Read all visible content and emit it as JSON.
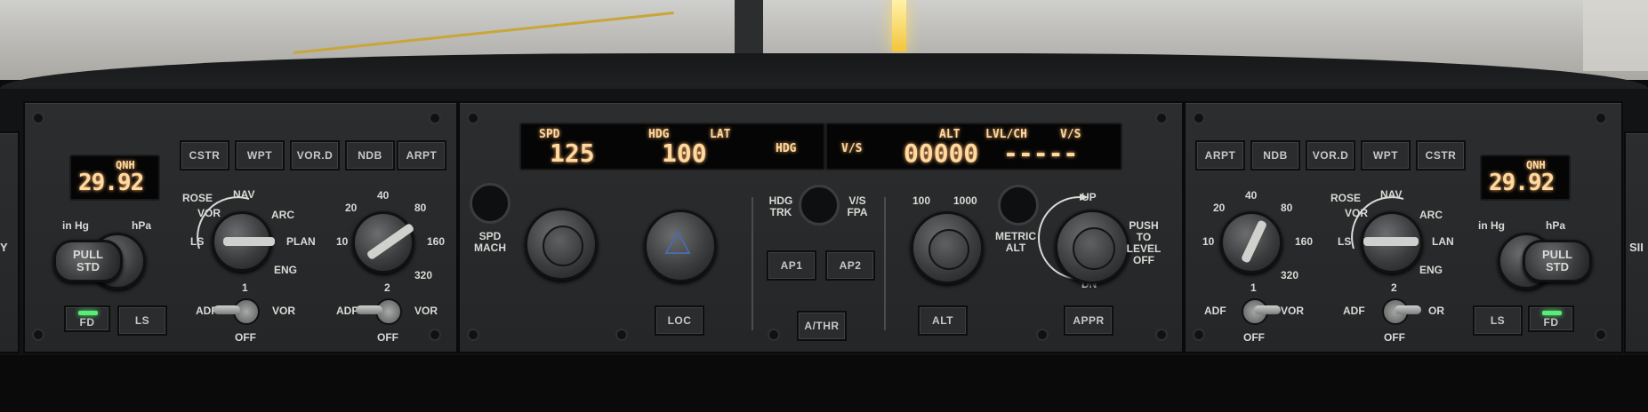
{
  "fcu": {
    "display_left": {
      "spd_label": "SPD",
      "spd_value": "125",
      "hdg_label": "HDG",
      "lat_label": "LAT",
      "hdg_value": "100",
      "hdg_mode": "HDG"
    },
    "display_right": {
      "vs_mode": "V/S",
      "alt_label": "ALT",
      "lvl_ch_label": "LVL/CH",
      "vs_label": "V/S",
      "alt_value": "00000",
      "vs_value": "-----"
    },
    "labels": {
      "spd_mach": [
        "SPD",
        "MACH"
      ],
      "hdg_trk": [
        "HDG",
        "TRK"
      ],
      "vs_fpa": [
        "V/S",
        "FPA"
      ],
      "metric_alt": [
        "METRIC",
        "ALT"
      ],
      "push_to_level_off": [
        "PUSH",
        "TO",
        "LEVEL",
        "OFF"
      ],
      "alt_100": "100",
      "alt_1000": "1000",
      "up": "UP",
      "dn": "DN"
    },
    "buttons": {
      "loc": "LOC",
      "ap1": "AP1",
      "ap2": "AP2",
      "athr": "A/THR",
      "alt": "ALT",
      "appr": "APPR"
    }
  },
  "efis_left": {
    "qnh_label": "QNH",
    "qnh_value": "29.92",
    "baro_units": {
      "inhg": "in Hg",
      "hpa": "hPa"
    },
    "baro_knob": [
      "PULL",
      "STD"
    ],
    "nav_buttons": [
      "CSTR",
      "WPT",
      "VOR.D",
      "NDB",
      "ARPT"
    ],
    "mode_labels": {
      "rose": "ROSE",
      "vor": "VOR",
      "nav": "NAV",
      "arc": "ARC",
      "ls": "LS",
      "plan": "PLAN",
      "eng": "ENG"
    },
    "range_labels": [
      "10",
      "20",
      "40",
      "80",
      "160",
      "320"
    ],
    "fd": "FD",
    "ls": "LS",
    "switch1": {
      "num": "1",
      "adf": "ADF",
      "vor": "VOR",
      "off": "OFF"
    },
    "switch2": {
      "num": "2",
      "adf": "ADF",
      "vor": "VOR",
      "off": "OFF"
    }
  },
  "efis_right": {
    "qnh_label": "QNH",
    "qnh_value": "29.92",
    "baro_units": {
      "inhg": "in Hg",
      "hpa": "hPa"
    },
    "baro_knob": [
      "PULL",
      "STD"
    ],
    "nav_buttons": [
      "ARPT",
      "NDB",
      "VOR.D",
      "WPT",
      "CSTR"
    ],
    "mode_labels": {
      "rose": "ROSE",
      "vor": "VOR",
      "nav": "NAV",
      "arc": "ARC",
      "ls": "LS",
      "plan": "LAN",
      "eng": "ENG"
    },
    "range_labels": [
      "10",
      "20",
      "40",
      "80",
      "160",
      "320"
    ],
    "fd": "FD",
    "ls": "LS",
    "switch1": {
      "num": "1",
      "adf": "ADF",
      "vor": "VOR",
      "off": "OFF"
    },
    "switch2": {
      "num": "2",
      "adf": "ADF",
      "vor": "OR",
      "off": "OFF"
    }
  },
  "edge_labels": {
    "left": "Y",
    "right": "SII"
  },
  "colors": {
    "lcd_text": "#ffd9a0",
    "fd_lamp": "#59ef74",
    "taxi_line": "#c9a63a"
  }
}
